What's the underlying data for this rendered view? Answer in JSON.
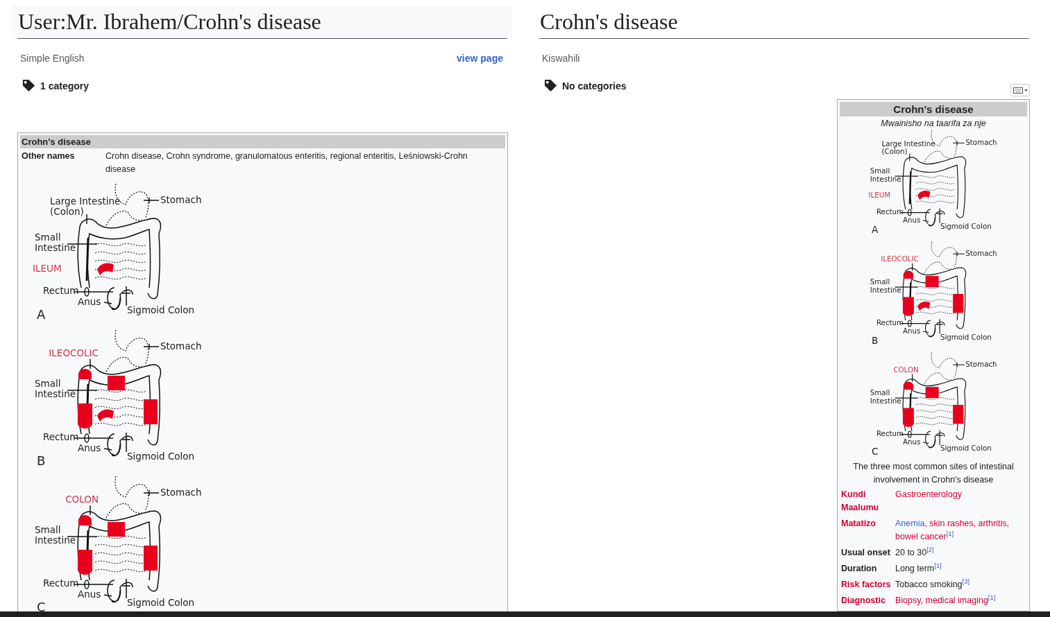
{
  "left_pane": {
    "title": "User:Mr. Ibrahem/Crohn's disease",
    "language": "Simple English",
    "view_link": "view page",
    "categories": "1 category",
    "infobox": {
      "title": "Crohn's disease",
      "rows": [
        {
          "label": "Other names",
          "value": "Crohn disease, Crohn syndrome, granulomatous enteritis, regional enteritis, Leśniowski-Crohn disease"
        }
      ],
      "diagrams": [
        {
          "highlights": {
            "ileum": true,
            "cecum": false,
            "ascending": false,
            "transverse": false,
            "descending": false
          },
          "labels": {
            "stomach": "Stomach",
            "large_intestine": "Large Intestine\n(Colon)",
            "small_intestine": "Small\nIntestine",
            "site_low": "ILEUM",
            "rectum": "Rectum",
            "anus": "Anus",
            "letter": "A",
            "sigmoid": "Sigmoid Colon"
          }
        },
        {
          "highlights": {
            "ileum": true,
            "cecum": true,
            "ascending": true,
            "transverse": true,
            "descending": true
          },
          "labels": {
            "stomach": "Stomach",
            "site_top": "ILEOCOLIC",
            "small_intestine": "Small\nIntestine",
            "rectum": "Rectum",
            "anus": "Anus",
            "letter": "B",
            "sigmoid": "Sigmoid Colon"
          }
        },
        {
          "highlights": {
            "ileum": false,
            "cecum": true,
            "ascending": true,
            "transverse": true,
            "descending": true
          },
          "labels": {
            "stomach": "Stomach",
            "site_top": "COLON",
            "small_intestine": "Small\nIntestine",
            "rectum": "Rectum",
            "anus": "Anus",
            "letter": "C",
            "sigmoid": "Sigmoid Colon"
          }
        }
      ]
    }
  },
  "right_pane": {
    "title": "Crohn's disease",
    "language": "Kiswahili",
    "categories": "No categories",
    "infobox": {
      "title": "Crohn's disease",
      "subtitle": "Mwainisho na taarifa za nje",
      "diagrams": [
        {
          "highlights": {
            "ileum": true,
            "cecum": false,
            "ascending": false,
            "transverse": false,
            "descending": false
          },
          "labels": {
            "stomach": "Stomach",
            "large_intestine": "Large Intestine\n(Colon)",
            "small_intestine": "Small\nIntestine",
            "site_low": "ILEUM",
            "rectum": "Rectum",
            "anus": "Anus",
            "letter": "A",
            "sigmoid": "Sigmoid Colon"
          }
        },
        {
          "highlights": {
            "ileum": true,
            "cecum": true,
            "ascending": true,
            "transverse": true,
            "descending": true
          },
          "labels": {
            "stomach": "Stomach",
            "site_top": "ILEOCOLIC",
            "small_intestine": "Small\nIntestine",
            "rectum": "Rectum",
            "anus": "Anus",
            "letter": "B",
            "sigmoid": "Sigmoid Colon"
          }
        },
        {
          "highlights": {
            "ileum": false,
            "cecum": true,
            "ascending": true,
            "transverse": true,
            "descending": true
          },
          "labels": {
            "stomach": "Stomach",
            "site_top": "COLON",
            "small_intestine": "Small\nIntestine",
            "rectum": "Rectum",
            "anus": "Anus",
            "letter": "C",
            "sigmoid": "Sigmoid Colon"
          }
        }
      ],
      "caption": "The three most common sites of intestinal involvement in Crohn's disease",
      "rows": [
        {
          "label": "Kundi Maalumu",
          "is_link": true,
          "value": [
            {
              "text": "Gastroenterology",
              "kind": "redlink"
            }
          ]
        },
        {
          "label": "Matatizo",
          "is_link": true,
          "value": [
            {
              "text": "Anemia",
              "kind": "link"
            },
            {
              "text": ", skin rashes, arthritis, bowel cancer$^{[1]}$",
              "kind": "redlink"
            }
          ]
        },
        {
          "label": "Usual onset",
          "is_link": false,
          "value": [
            {
              "text": "20 to 30$^{[2]}$",
              "kind": "plain"
            }
          ]
        },
        {
          "label": "Duration",
          "is_link": false,
          "value": [
            {
              "text": "Long term$^{[1]}$",
              "kind": "plain"
            }
          ]
        },
        {
          "label": "Risk factors",
          "is_link": true,
          "value": [
            {
              "text": "Tobacco smoking$^{[3]}$",
              "kind": "plain"
            }
          ]
        },
        {
          "label": "Diagnostic",
          "is_link": true,
          "value": [
            {
              "text": "Biopsy, medical imaging$^{[1]}$",
              "kind": "redlink"
            }
          ]
        }
      ]
    }
  }
}
